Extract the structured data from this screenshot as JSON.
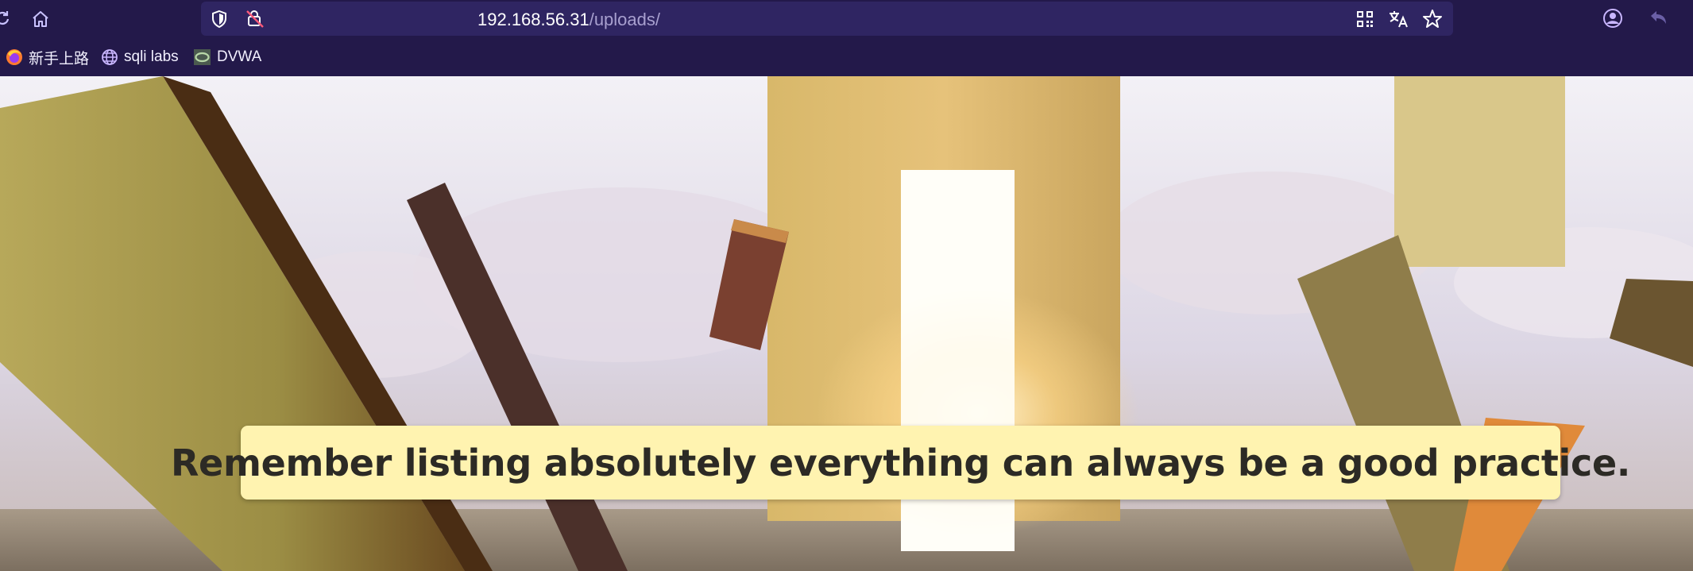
{
  "toolbar": {
    "reload_icon": "reload-icon",
    "home_icon": "home-icon"
  },
  "address_bar": {
    "host": "192.168.56.31",
    "path": "/uploads/",
    "shield_icon": "tracking-protection-shield-icon",
    "lock_icon": "insecure-connection-icon",
    "qr_icon": "qr-code-icon",
    "translate_icon": "translate-icon",
    "bookmark_icon": "star-icon"
  },
  "toolbar_right": {
    "account_icon": "account-icon",
    "back_icon": "undo-icon"
  },
  "bookmarks": [
    {
      "label": "新手上路",
      "icon": "firefox-icon"
    },
    {
      "label": "sqli labs",
      "icon": "globe-icon"
    },
    {
      "label": "DVWA",
      "icon": "dvwa-favicon"
    }
  ],
  "page": {
    "message": "Remember listing absolutely everything can always be a good practice."
  },
  "colors": {
    "chrome_bg": "#23194a",
    "urlbar_bg": "#2f2562",
    "banner_bg": "#fff3b0",
    "banner_text": "#2c2a25"
  }
}
